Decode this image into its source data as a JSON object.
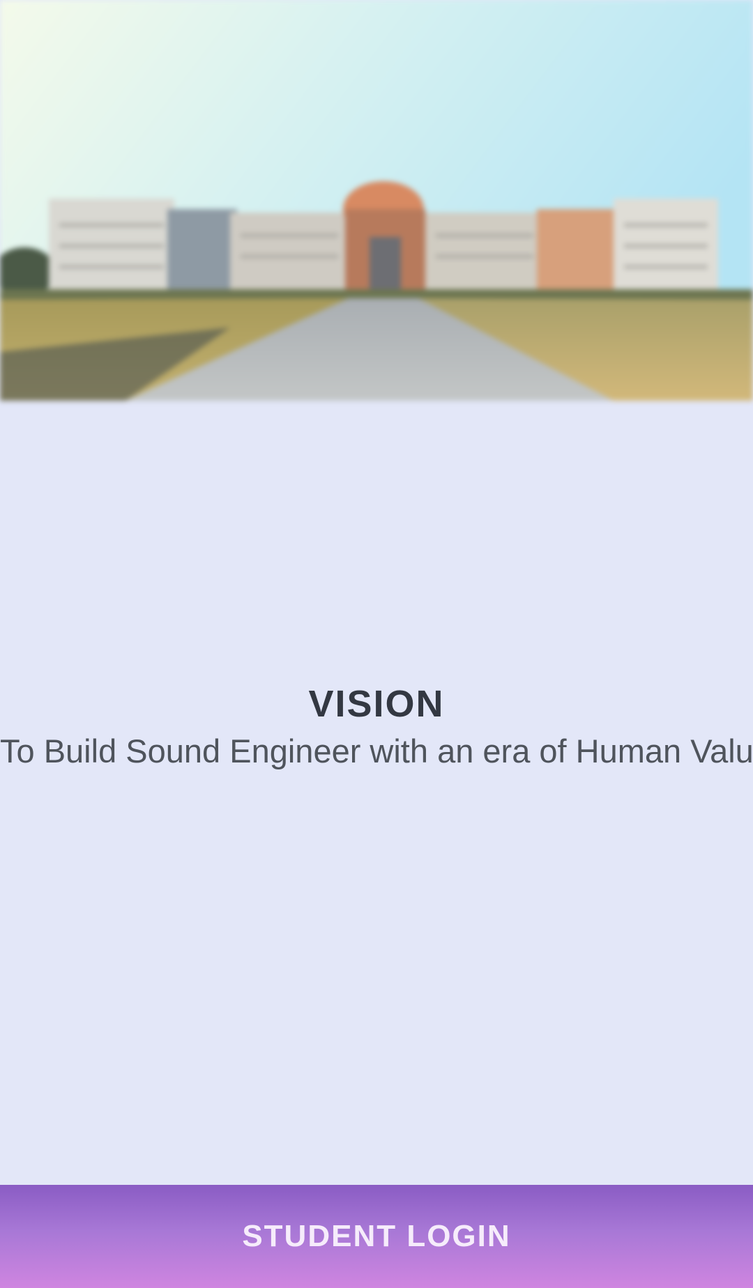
{
  "hero": {
    "image": "campus-building-photo"
  },
  "vision": {
    "title": "VISION",
    "text": "To Build Sound Engineer with an era of Human Values"
  },
  "login_button": {
    "label": "STUDENT LOGIN"
  },
  "colors": {
    "background": "#e3e7f8",
    "button_top": "#8a5cc4",
    "button_bottom": "#cf85e0",
    "title": "#333842",
    "text": "#4f545c"
  }
}
